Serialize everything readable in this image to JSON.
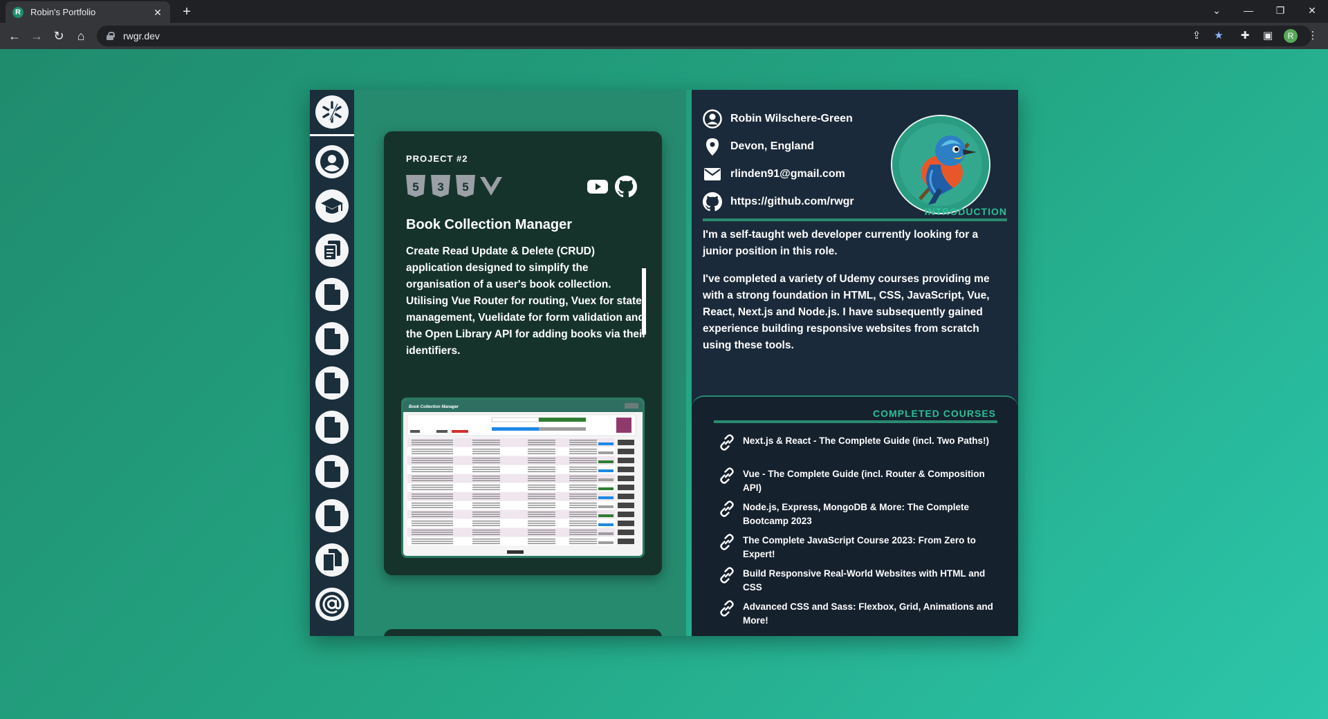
{
  "browser": {
    "tab_title": "Robin's Portfolio",
    "tab_favicon_letter": "R",
    "url": "rwgr.dev",
    "profile_initial": "R"
  },
  "sidebar": {
    "items": [
      {
        "name": "logo",
        "icon": "star-logo-icon"
      },
      {
        "name": "profile",
        "icon": "user-circle-icon"
      },
      {
        "name": "education",
        "icon": "graduation-cap-icon"
      },
      {
        "name": "projects",
        "icon": "clipboard-icon"
      },
      {
        "name": "project-1",
        "icon": "file-icon"
      },
      {
        "name": "project-2",
        "icon": "file-icon"
      },
      {
        "name": "project-3",
        "icon": "file-icon"
      },
      {
        "name": "project-4",
        "icon": "file-icon"
      },
      {
        "name": "project-5",
        "icon": "file-icon"
      },
      {
        "name": "project-6",
        "icon": "file-icon"
      },
      {
        "name": "more-projects",
        "icon": "copy-icon"
      },
      {
        "name": "contact",
        "icon": "at-sign-icon"
      }
    ]
  },
  "project": {
    "label": "PROJECT #2",
    "tech": [
      "html5-icon",
      "css3-icon",
      "javascript-icon",
      "vue-icon"
    ],
    "links": [
      "youtube-icon",
      "github-icon"
    ],
    "title": "Book Collection Manager",
    "description": "Create Read Update & Delete (CRUD) application designed to simplify the organisation of a user's book collection. Utilising Vue Router for routing, Vuex for state management, Vuelidate for form validation and the Open Library API for adding books via their identifiers.",
    "screenshot_title": "Book Collection Manager"
  },
  "profile": {
    "name": "Robin Wilschere-Green",
    "location": "Devon, England",
    "email": "rlinden91@gmail.com",
    "github": "https://github.com/rwgr",
    "avatar": "bird-avatar"
  },
  "introduction": {
    "heading": "INTRODUCTION",
    "paragraphs": [
      "I'm a self-taught web developer currently looking for a junior position in this role.",
      "I've completed a variety of Udemy courses providing me with a strong foundation in HTML, CSS, JavaScript, Vue, React, Next.js and Node.js. I have subsequently gained experience building responsive websites from scratch using these tools."
    ]
  },
  "courses": {
    "heading": "COMPLETED COURSES",
    "items": [
      "Next.js & React - The Complete Guide (incl. Two Paths!)",
      "Vue - The Complete Guide (incl. Router & Composition API)",
      "Node.js, Express, MongoDB & More: The Complete Bootcamp 2023",
      "The Complete JavaScript Course 2023: From Zero to Expert!",
      "Build Responsive Real-World Websites with HTML and CSS",
      "Advanced CSS and Sass: Flexbox, Grid, Animations and More!"
    ]
  },
  "colors": {
    "background": "#23a785",
    "sidebar": "#1b2e3c",
    "middle": "#268a6e",
    "project_card": "#16332b",
    "right_panel": "#1b2a3a",
    "accent": "#2bbf95"
  }
}
